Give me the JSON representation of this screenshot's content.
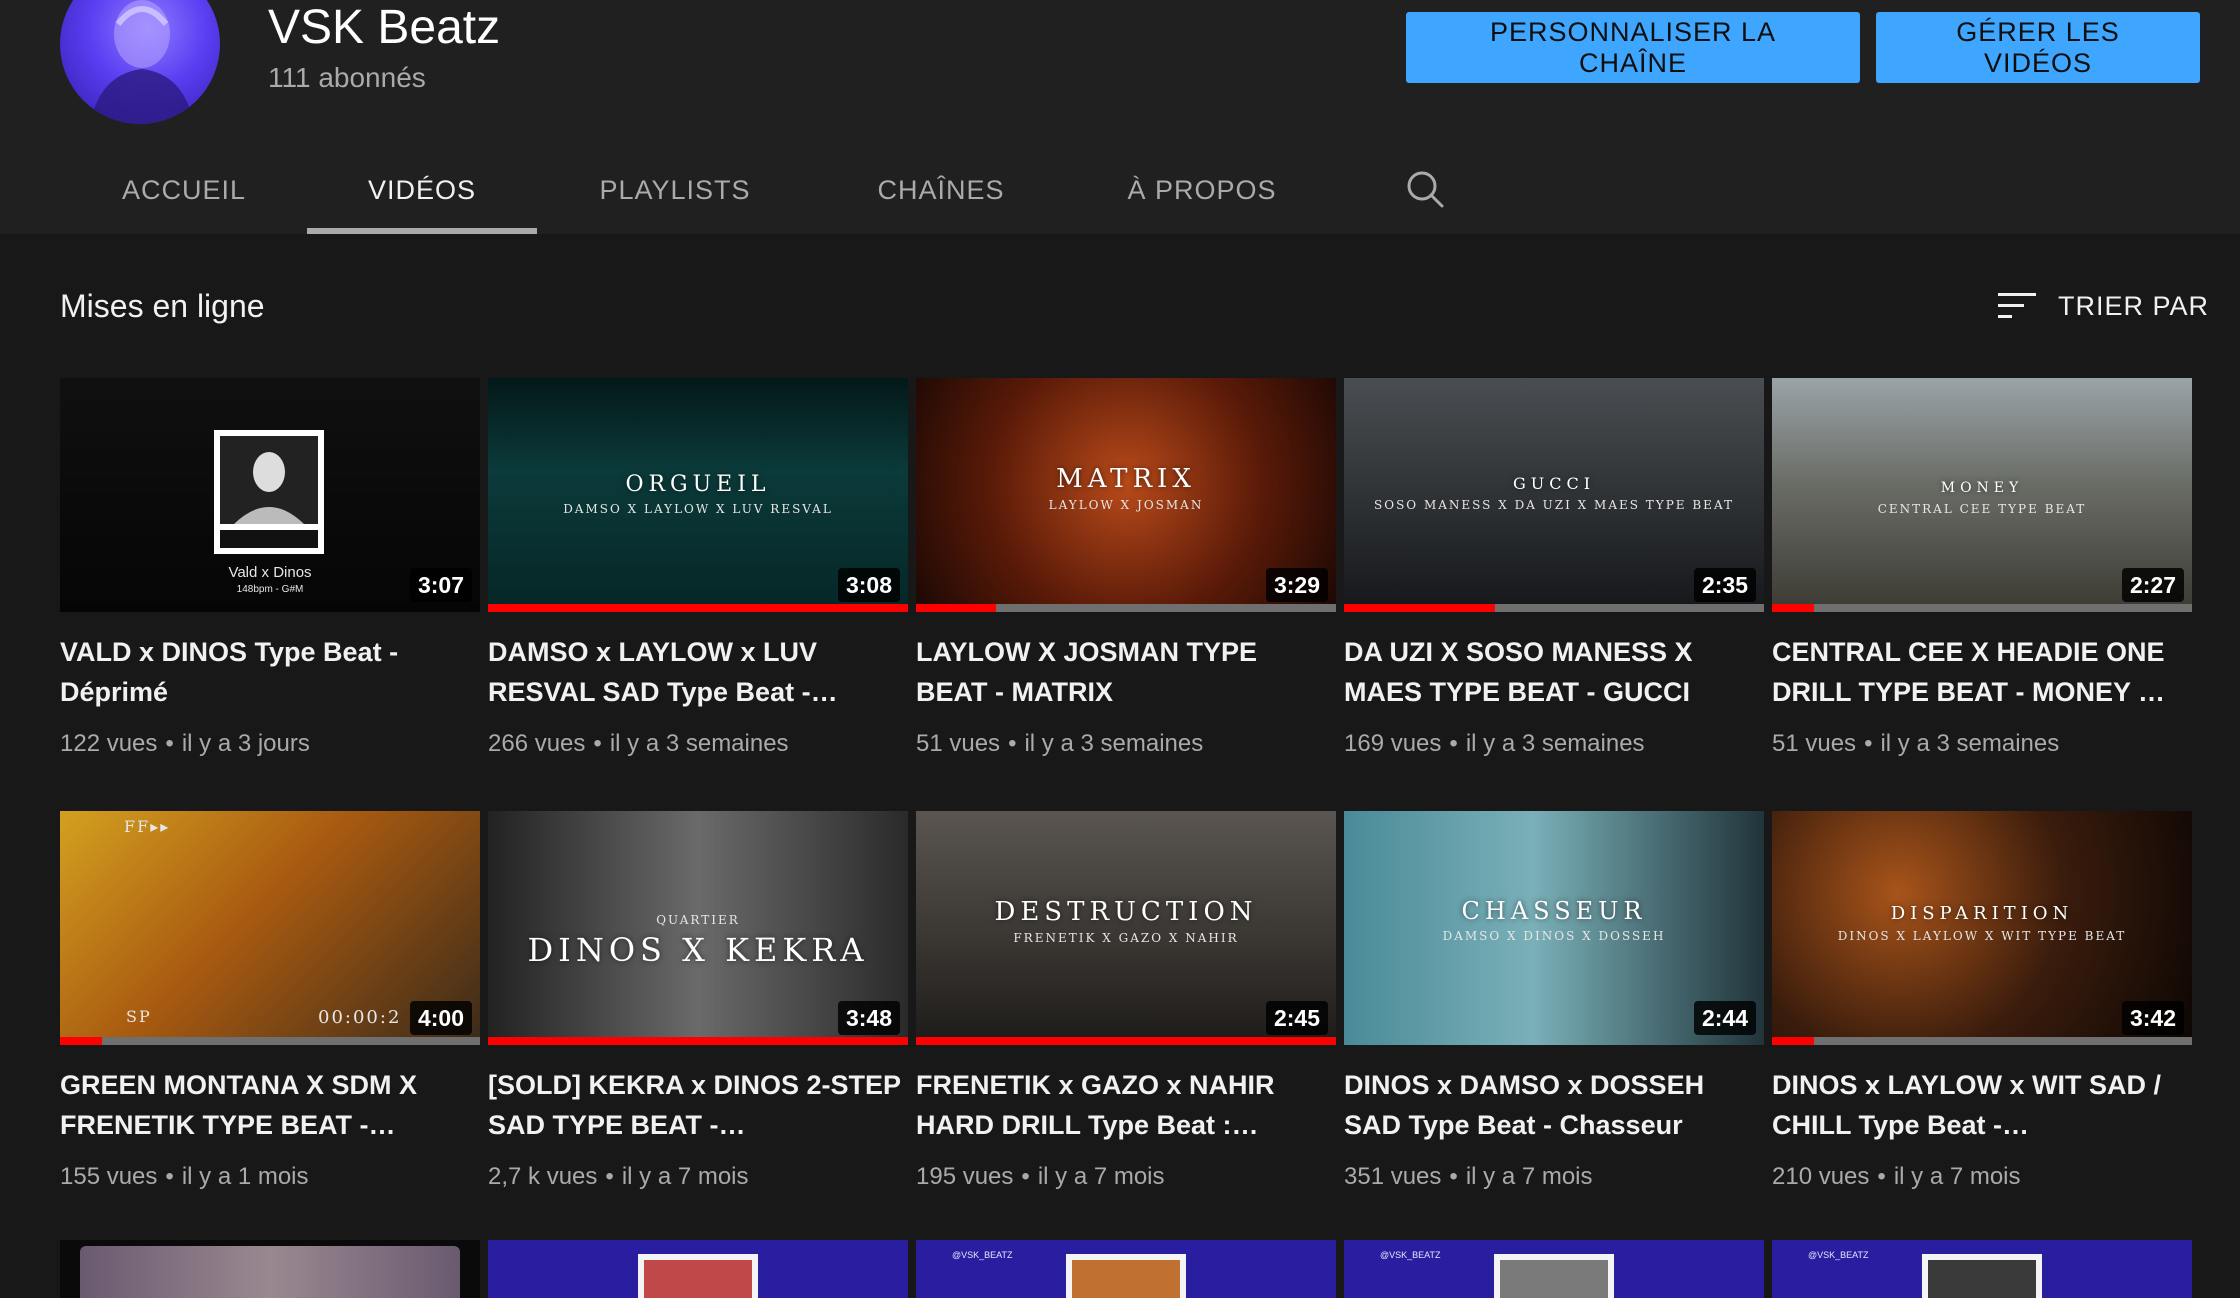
{
  "channel": {
    "name": "VSK Beatz",
    "subscribers": "111 abonnés",
    "customize_label": "PERSONNALISER LA CHAÎNE",
    "manage_label": "GÉRER LES VIDÉOS"
  },
  "tabs": [
    {
      "label": "ACCUEIL",
      "active": false
    },
    {
      "label": "VIDÉOS",
      "active": true
    },
    {
      "label": "PLAYLISTS",
      "active": false
    },
    {
      "label": "CHAÎNES",
      "active": false
    },
    {
      "label": "À PROPOS",
      "active": false
    }
  ],
  "section": {
    "title": "Mises en ligne",
    "sort_label": "TRIER PAR"
  },
  "videos": [
    {
      "title": "VALD x DINOS Type Beat - Déprimé",
      "views": "122 vues",
      "age": "il y a 3 jours",
      "duration": "3:07",
      "watched": 0,
      "thumb": {
        "caption": "",
        "sub": "Vald x Dinos",
        "sub2": "148bpm - G#M"
      }
    },
    {
      "title": "DAMSO x LAYLOW x LUV RESVAL SAD Type Beat -…",
      "views": "266 vues",
      "age": "il y a 3 semaines",
      "duration": "3:08",
      "watched": 1.0,
      "thumb": {
        "caption": "ORGUEIL",
        "sub": "DAMSO X LAYLOW X LUV RESVAL"
      }
    },
    {
      "title": "LAYLOW X JOSMAN TYPE BEAT - MATRIX",
      "views": "51 vues",
      "age": "il y a 3 semaines",
      "duration": "3:29",
      "watched": 0.19,
      "thumb": {
        "caption": "MATRIX",
        "sub": "LAYLOW X JOSMAN"
      }
    },
    {
      "title": "DA UZI X SOSO MANESS X MAES TYPE BEAT - GUCCI",
      "views": "169 vues",
      "age": "il y a 3 semaines",
      "duration": "2:35",
      "watched": 0.36,
      "thumb": {
        "caption": "GUCCI",
        "sub": "SOSO MANESS X DA UZI X MAES TYPE BEAT"
      }
    },
    {
      "title": "CENTRAL CEE X HEADIE ONE DRILL TYPE BEAT - MONEY …",
      "views": "51 vues",
      "age": "il y a 3 semaines",
      "duration": "2:27",
      "watched": 0.1,
      "thumb": {
        "caption": "MONEY",
        "sub": "CENTRAL CEE TYPE BEAT"
      }
    },
    {
      "title": "GREEN MONTANA X SDM X FRENETIK TYPE BEAT -…",
      "views": "155 vues",
      "age": "il y a 1 mois",
      "duration": "4:00",
      "watched": 0.1,
      "thumb": {
        "caption": "",
        "sub": "FF▸▸",
        "sub2": "SP",
        "sub3": "00:00:2"
      }
    },
    {
      "title": "[SOLD] KEKRA x DINOS 2-STEP SAD TYPE BEAT -…",
      "views": "2,7 k vues",
      "age": "il y a 7 mois",
      "duration": "3:48",
      "watched": 1.0,
      "thumb": {
        "caption": "DINOS X KEKRA",
        "sub": "QUARTIER"
      }
    },
    {
      "title": "FRENETIK x GAZO x NAHIR HARD DRILL Type Beat :…",
      "views": "195 vues",
      "age": "il y a 7 mois",
      "duration": "2:45",
      "watched": 1.0,
      "thumb": {
        "caption": "DESTRUCTION",
        "sub": "FRENETIK X GAZO X NAHIR"
      }
    },
    {
      "title": "DINOS x DAMSO x DOSSEH SAD Type Beat - Chasseur",
      "views": "351 vues",
      "age": "il y a 7 mois",
      "duration": "2:44",
      "watched": 0,
      "thumb": {
        "caption": "CHASSEUR",
        "sub": "DAMSO X DINOS X DOSSEH"
      }
    },
    {
      "title": "DINOS x LAYLOW x WIT SAD / CHILL Type Beat -…",
      "views": "210 vues",
      "age": "il y a 7 mois",
      "duration": "3:42",
      "watched": 0.1,
      "thumb": {
        "caption": "DISPARITION",
        "sub": "DINOS X LAYLOW X WIT TYPE BEAT"
      }
    }
  ],
  "peek_handle": "@VSK_BEATZ",
  "colors": {
    "background": "#181818",
    "header": "#202020",
    "accent_button": "#3ea6ff",
    "progress": "#ff0000"
  }
}
